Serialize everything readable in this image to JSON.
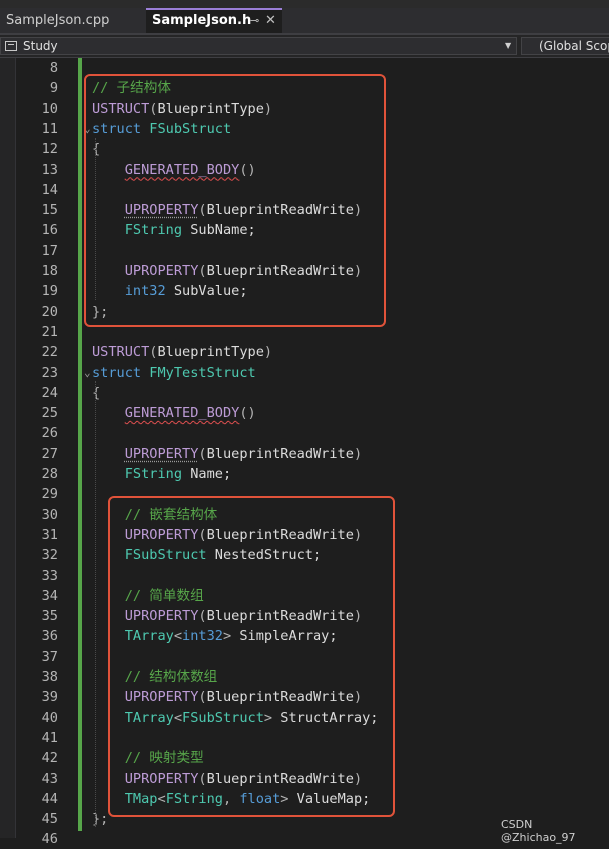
{
  "tabs": [
    {
      "label": "SampleJson.cpp",
      "active": false
    },
    {
      "label": "SampleJson.h",
      "active": true,
      "pin_icon": "pin-icon",
      "close_icon": "close-icon"
    }
  ],
  "navbar": {
    "project": "Study",
    "scope": "(Global Scope)"
  },
  "colors": {
    "accent_tab": "#9b7fd8",
    "change_bar": "#57a64a",
    "highlight_box": "#e0533a"
  },
  "lines": [
    {
      "n": "8",
      "tokens": []
    },
    {
      "n": "9",
      "tokens": [
        {
          "t": "// 子结构体",
          "c": "comment"
        }
      ]
    },
    {
      "n": "10",
      "tokens": [
        {
          "t": "USTRUCT",
          "c": "macro"
        },
        {
          "t": "(",
          "c": "punc"
        },
        {
          "t": "BlueprintType",
          "c": "id"
        },
        {
          "t": ")",
          "c": "punc"
        }
      ]
    },
    {
      "n": "11",
      "fold": "⌄",
      "tokens": [
        {
          "t": "struct ",
          "c": "kw"
        },
        {
          "t": "FSubStruct",
          "c": "type"
        }
      ]
    },
    {
      "n": "12",
      "tokens": [
        {
          "t": "{",
          "c": "punc"
        }
      ]
    },
    {
      "n": "13",
      "tokens": [
        {
          "t": "    ",
          "c": "id"
        },
        {
          "t": "GENERATED_BODY",
          "c": "squig"
        },
        {
          "t": "()",
          "c": "punc"
        }
      ]
    },
    {
      "n": "14",
      "tokens": []
    },
    {
      "n": "15",
      "tokens": [
        {
          "t": "    ",
          "c": "id"
        },
        {
          "t": "UPROPERTY",
          "c": "dots"
        },
        {
          "t": "(",
          "c": "punc"
        },
        {
          "t": "BlueprintReadWrite",
          "c": "id"
        },
        {
          "t": ")",
          "c": "punc"
        }
      ]
    },
    {
      "n": "16",
      "tokens": [
        {
          "t": "    ",
          "c": "id"
        },
        {
          "t": "FString",
          "c": "type"
        },
        {
          "t": " SubName;",
          "c": "id"
        }
      ]
    },
    {
      "n": "17",
      "tokens": []
    },
    {
      "n": "18",
      "tokens": [
        {
          "t": "    ",
          "c": "id"
        },
        {
          "t": "UPROPERTY",
          "c": "macro"
        },
        {
          "t": "(",
          "c": "punc"
        },
        {
          "t": "BlueprintReadWrite",
          "c": "id"
        },
        {
          "t": ")",
          "c": "punc"
        }
      ]
    },
    {
      "n": "19",
      "tokens": [
        {
          "t": "    ",
          "c": "id"
        },
        {
          "t": "int32",
          "c": "kw"
        },
        {
          "t": " SubValue;",
          "c": "id"
        }
      ]
    },
    {
      "n": "20",
      "tokens": [
        {
          "t": "};",
          "c": "punc"
        }
      ]
    },
    {
      "n": "21",
      "tokens": []
    },
    {
      "n": "22",
      "tokens": [
        {
          "t": "USTRUCT",
          "c": "macro"
        },
        {
          "t": "(",
          "c": "punc"
        },
        {
          "t": "BlueprintType",
          "c": "id"
        },
        {
          "t": ")",
          "c": "punc"
        }
      ]
    },
    {
      "n": "23",
      "fold": "⌄",
      "tokens": [
        {
          "t": "struct ",
          "c": "kw"
        },
        {
          "t": "FMyTestStruct",
          "c": "type"
        }
      ]
    },
    {
      "n": "24",
      "tokens": [
        {
          "t": "{",
          "c": "punc"
        }
      ]
    },
    {
      "n": "25",
      "tokens": [
        {
          "t": "    ",
          "c": "id"
        },
        {
          "t": "GENERATED_BODY",
          "c": "squig"
        },
        {
          "t": "()",
          "c": "punc"
        }
      ]
    },
    {
      "n": "26",
      "tokens": []
    },
    {
      "n": "27",
      "tokens": [
        {
          "t": "    ",
          "c": "id"
        },
        {
          "t": "UPROPERTY",
          "c": "dots"
        },
        {
          "t": "(",
          "c": "punc"
        },
        {
          "t": "BlueprintReadWrite",
          "c": "id"
        },
        {
          "t": ")",
          "c": "punc"
        }
      ]
    },
    {
      "n": "28",
      "tokens": [
        {
          "t": "    ",
          "c": "id"
        },
        {
          "t": "FString",
          "c": "type"
        },
        {
          "t": " Name;",
          "c": "id"
        }
      ]
    },
    {
      "n": "29",
      "tokens": []
    },
    {
      "n": "30",
      "tokens": [
        {
          "t": "    ",
          "c": "id"
        },
        {
          "t": "// 嵌套结构体",
          "c": "comment"
        }
      ]
    },
    {
      "n": "31",
      "tokens": [
        {
          "t": "    ",
          "c": "id"
        },
        {
          "t": "UPROPERTY",
          "c": "macro"
        },
        {
          "t": "(",
          "c": "punc"
        },
        {
          "t": "BlueprintReadWrite",
          "c": "id"
        },
        {
          "t": ")",
          "c": "punc"
        }
      ]
    },
    {
      "n": "32",
      "tokens": [
        {
          "t": "    ",
          "c": "id"
        },
        {
          "t": "FSubStruct",
          "c": "type"
        },
        {
          "t": " NestedStruct;",
          "c": "id"
        }
      ]
    },
    {
      "n": "33",
      "tokens": []
    },
    {
      "n": "34",
      "tokens": [
        {
          "t": "    ",
          "c": "id"
        },
        {
          "t": "// 简单数组",
          "c": "comment"
        }
      ]
    },
    {
      "n": "35",
      "tokens": [
        {
          "t": "    ",
          "c": "id"
        },
        {
          "t": "UPROPERTY",
          "c": "macro"
        },
        {
          "t": "(",
          "c": "punc"
        },
        {
          "t": "BlueprintReadWrite",
          "c": "id"
        },
        {
          "t": ")",
          "c": "punc"
        }
      ]
    },
    {
      "n": "36",
      "tokens": [
        {
          "t": "    ",
          "c": "id"
        },
        {
          "t": "TArray",
          "c": "type"
        },
        {
          "t": "<",
          "c": "punc"
        },
        {
          "t": "int32",
          "c": "kw"
        },
        {
          "t": ">",
          "c": "punc"
        },
        {
          "t": " SimpleArray;",
          "c": "id"
        }
      ]
    },
    {
      "n": "37",
      "tokens": []
    },
    {
      "n": "38",
      "tokens": [
        {
          "t": "    ",
          "c": "id"
        },
        {
          "t": "// 结构体数组",
          "c": "comment"
        }
      ]
    },
    {
      "n": "39",
      "tokens": [
        {
          "t": "    ",
          "c": "id"
        },
        {
          "t": "UPROPERTY",
          "c": "macro"
        },
        {
          "t": "(",
          "c": "punc"
        },
        {
          "t": "BlueprintReadWrite",
          "c": "id"
        },
        {
          "t": ")",
          "c": "punc"
        }
      ]
    },
    {
      "n": "40",
      "tokens": [
        {
          "t": "    ",
          "c": "id"
        },
        {
          "t": "TArray",
          "c": "type"
        },
        {
          "t": "<",
          "c": "punc"
        },
        {
          "t": "FSubStruct",
          "c": "type"
        },
        {
          "t": ">",
          "c": "punc"
        },
        {
          "t": " StructArray;",
          "c": "id"
        }
      ]
    },
    {
      "n": "41",
      "tokens": []
    },
    {
      "n": "42",
      "tokens": [
        {
          "t": "    ",
          "c": "id"
        },
        {
          "t": "// 映射类型",
          "c": "comment"
        }
      ]
    },
    {
      "n": "43",
      "tokens": [
        {
          "t": "    ",
          "c": "id"
        },
        {
          "t": "UPROPERTY",
          "c": "macro"
        },
        {
          "t": "(",
          "c": "punc"
        },
        {
          "t": "BlueprintReadWrite",
          "c": "id"
        },
        {
          "t": ")",
          "c": "punc"
        }
      ]
    },
    {
      "n": "44",
      "tokens": [
        {
          "t": "    ",
          "c": "id"
        },
        {
          "t": "TMap",
          "c": "type"
        },
        {
          "t": "<",
          "c": "punc"
        },
        {
          "t": "FString",
          "c": "type"
        },
        {
          "t": ", ",
          "c": "punc"
        },
        {
          "t": "float",
          "c": "kw"
        },
        {
          "t": ">",
          "c": "punc"
        },
        {
          "t": " ValueMap;",
          "c": "id"
        }
      ]
    },
    {
      "n": "45",
      "tokens": [
        {
          "t": "};",
          "c": "punc"
        }
      ]
    },
    {
      "n": "46",
      "tokens": []
    }
  ],
  "watermark": "CSDN @Zhichao_97"
}
